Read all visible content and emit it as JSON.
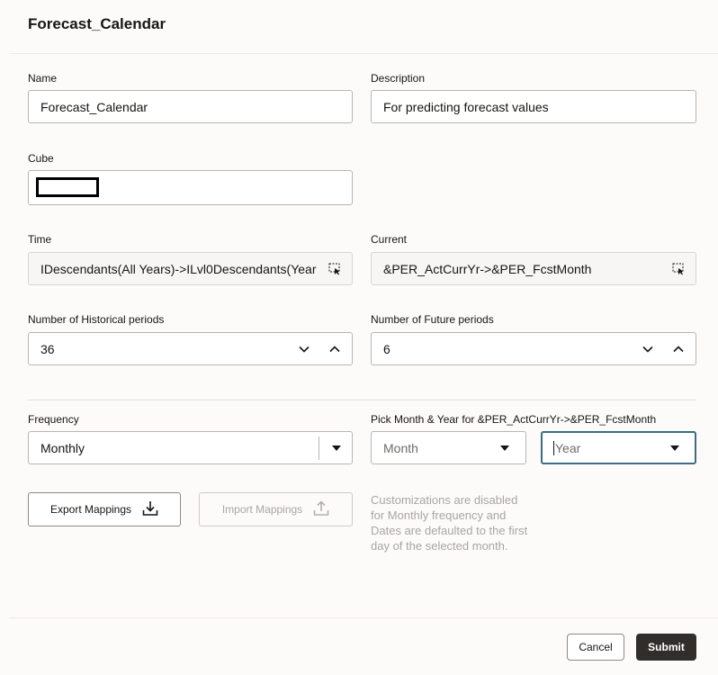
{
  "dialog": {
    "title": "Forecast_Calendar"
  },
  "name": {
    "label": "Name",
    "value": "Forecast_Calendar"
  },
  "description": {
    "label": "Description",
    "value": "For predicting forecast values"
  },
  "cube": {
    "label": "Cube",
    "value": ""
  },
  "time": {
    "label": "Time",
    "value": "IDescendants(All Years)->ILvl0Descendants(Year"
  },
  "current": {
    "label": "Current",
    "value": "&PER_ActCurrYr->&PER_FcstMonth"
  },
  "historical": {
    "label": "Number of Historical periods",
    "value": "36"
  },
  "future": {
    "label": "Number of Future periods",
    "value": "6"
  },
  "frequency": {
    "label": "Frequency",
    "value": "Monthly"
  },
  "pick": {
    "label": "Pick Month & Year for &PER_ActCurrYr->&PER_FcstMonth",
    "month_placeholder": "Month",
    "year_placeholder": "Year"
  },
  "mappings": {
    "export_label": "Export Mappings",
    "import_label": "Import Mappings",
    "note": "Customizations are disabled for Monthly frequency and Dates are defaulted to the first day of the selected month."
  },
  "footer": {
    "cancel_label": "Cancel",
    "submit_label": "Submit"
  },
  "icons": {
    "selector": "member-selector-icon",
    "dropdown": "chevron-down-icon",
    "increment": "chevron-up-icon",
    "export": "download-icon",
    "import": "upload-icon"
  }
}
